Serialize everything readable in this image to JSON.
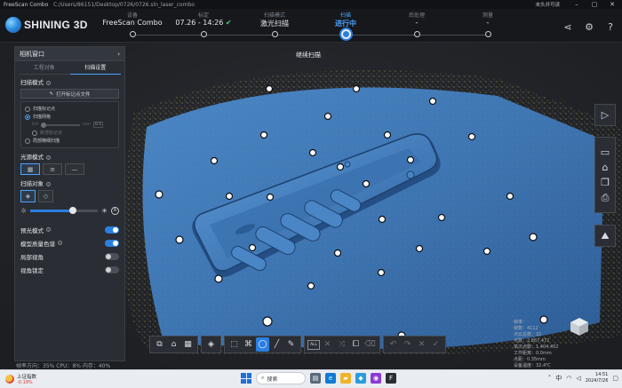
{
  "window": {
    "app_name": "FreeScan Combo",
    "path": "C:/Users/86151/Desktop/0726/0726.sln_laser_combo",
    "user": "未头并可读",
    "min_icon": "minimize-icon",
    "max_icon": "maximize-icon",
    "close_icon": "close-icon"
  },
  "header": {
    "logo_text": "SHINING 3D",
    "steps": [
      {
        "label": "设备",
        "value": "FreeScan Combo",
        "state": "done"
      },
      {
        "label": "标定",
        "value": "07.26 - 14:26",
        "check": "✔",
        "state": "done"
      },
      {
        "label": "扫描模式",
        "value": "激光扫描",
        "state": "done"
      },
      {
        "label": "扫描",
        "value": "进行中",
        "state": "active"
      },
      {
        "label": "后处理",
        "value": "-",
        "state": "pending"
      },
      {
        "label": "测量",
        "value": "-",
        "state": "pending"
      }
    ],
    "icons": [
      "share-icon",
      "settings-icon",
      "help-icon"
    ]
  },
  "viewport": {
    "continuous_label": "继续扫描"
  },
  "panel": {
    "camera_window": "相机窗口",
    "tabs": [
      {
        "label": "工程对象",
        "active": false
      },
      {
        "label": "扫描设置",
        "active": true
      }
    ],
    "scan_mode_title": "扫描模式",
    "open_marker_file": "打开标记点文件",
    "modes": [
      {
        "label": "扫描标记点",
        "on": false,
        "dim": false
      },
      {
        "label": "扫描网格",
        "on": true,
        "dim": false
      },
      {
        "label": "新增标记点",
        "on": false,
        "dim": true
      },
      {
        "label": "局部精细扫描",
        "on": false,
        "dim": false
      }
    ],
    "resolution_label": "0.0",
    "resolution_unit": "mm",
    "resolution_value": "0.5",
    "light_source_title": "光源模式",
    "scan_object_title": "扫描对象",
    "brightness_level": 0.63,
    "toggles": [
      {
        "label": "预光模式",
        "on": true
      },
      {
        "label": "模型质量色谱",
        "on": true
      },
      {
        "label": "局部视角",
        "on": false
      },
      {
        "label": "视角锁定",
        "on": false
      }
    ]
  },
  "toolbar": {
    "all_label": "ALL"
  },
  "stats": {
    "lines": [
      "帧率：",
      "帧数：4112",
      "点云总数：32",
      "点数：2,867,472",
      "单次点数：1,404,402",
      "工作距离：0.0mm",
      "点距：0.35mm",
      "设备温度：32.4℃"
    ]
  },
  "statusline": "帧率方向：35%  CPU：8%  内存：40%",
  "taskbar": {
    "weather_title": "上证指数",
    "weather_change": "-0.19%",
    "search_placeholder": "搜索",
    "time": "14:51",
    "date": "2024/7/26"
  },
  "colors": {
    "accent": "#2a7fe0",
    "check_green": "#44d16b",
    "scan_blue": "#3f78b8"
  }
}
